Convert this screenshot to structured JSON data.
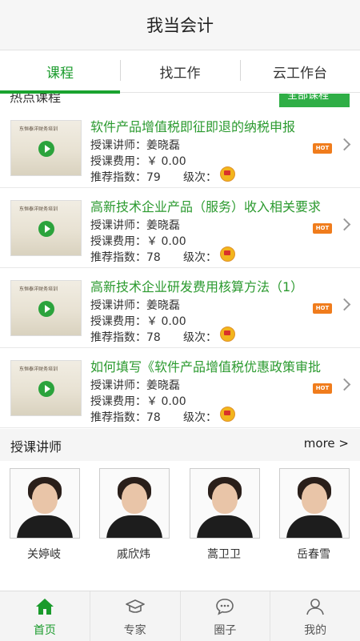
{
  "header": {
    "title": "我当会计"
  },
  "tabs": [
    {
      "label": "课程",
      "active": true
    },
    {
      "label": "找工作",
      "active": false
    },
    {
      "label": "云工作台",
      "active": false
    }
  ],
  "section": {
    "title": "热点课程",
    "all_button": "全部课程"
  },
  "courses": [
    {
      "title": "软件产品增值税即征即退的纳税申报",
      "teacher": "授课讲师：姜晓磊",
      "fee": "授课费用：￥ 0.00",
      "score": "推荐指数：79",
      "level_label": "级次：",
      "badge": "HOT",
      "thumb_brand": "东恒泰洋财务培训"
    },
    {
      "title": "高新技术企业产品（服务）收入相关要求",
      "teacher": "授课讲师：姜晓磊",
      "fee": "授课费用：￥ 0.00",
      "score": "推荐指数：78",
      "level_label": "级次：",
      "badge": "HOT",
      "thumb_brand": "东恒泰洋财务培训"
    },
    {
      "title": "高新技术企业研发费用核算方法（1）",
      "teacher": "授课讲师：姜晓磊",
      "fee": "授课费用：￥ 0.00",
      "score": "推荐指数：78",
      "level_label": "级次：",
      "badge": "HOT",
      "thumb_brand": "东恒泰洋财务培训"
    },
    {
      "title": "如何填写《软件产品增值税优惠政策审批",
      "teacher": "授课讲师：姜晓磊",
      "fee": "授课费用：￥ 0.00",
      "score": "推荐指数：78",
      "level_label": "级次：",
      "badge": "HOT",
      "thumb_brand": "东恒泰洋财务培训"
    }
  ],
  "teachers_section": {
    "title": "授课讲师",
    "more": "more >"
  },
  "teachers": [
    {
      "name": "关婷岐"
    },
    {
      "name": "戚欣炜"
    },
    {
      "name": "蒿卫卫"
    },
    {
      "name": "岳春雪"
    }
  ],
  "bottom_nav": [
    {
      "label": "首页",
      "icon": "home-icon",
      "active": true
    },
    {
      "label": "专家",
      "icon": "graduation-cap-icon",
      "active": false
    },
    {
      "label": "圈子",
      "icon": "chat-bubble-icon",
      "active": false
    },
    {
      "label": "我的",
      "icon": "user-icon",
      "active": false
    }
  ],
  "colors": {
    "accent": "#1a9b2c",
    "hot": "#f07c1c"
  }
}
